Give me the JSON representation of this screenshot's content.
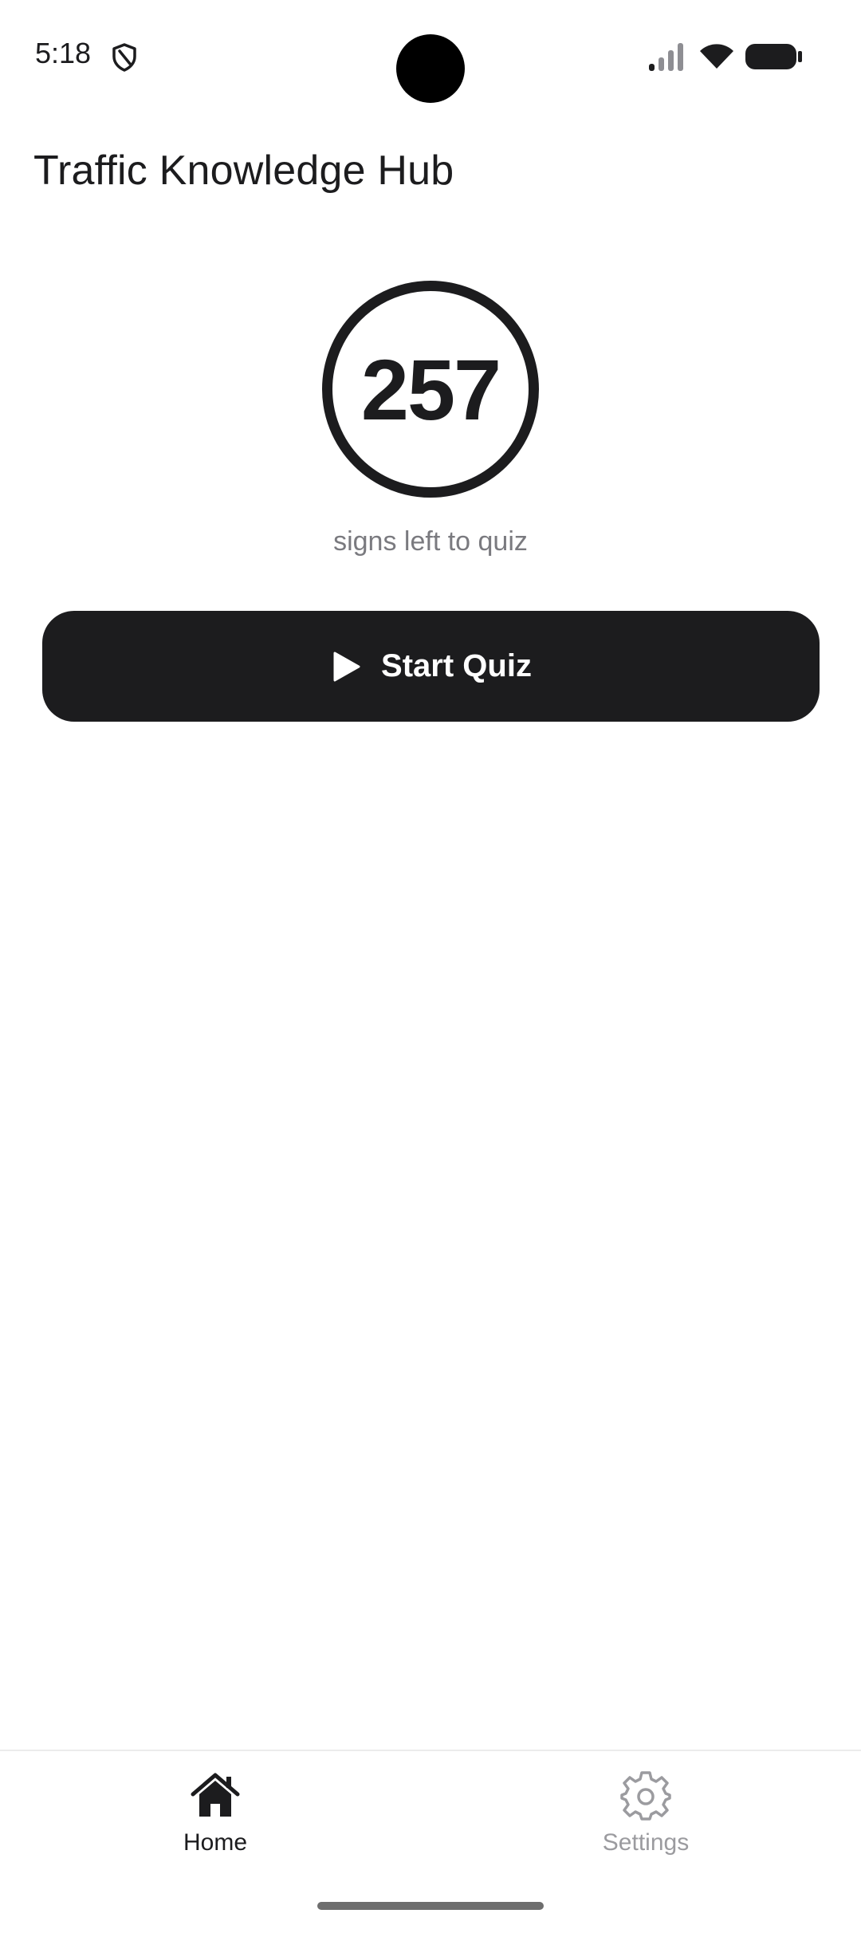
{
  "status_bar": {
    "time": "5:18",
    "icons": [
      "shield-icon",
      "signal-icon",
      "wifi-icon",
      "battery-icon"
    ]
  },
  "header": {
    "title": "Traffic Knowledge Hub"
  },
  "counter": {
    "value": "257",
    "caption": "signs left to quiz"
  },
  "start_button": {
    "label": "Start Quiz",
    "icon": "play-icon"
  },
  "tab_bar": {
    "tabs": [
      {
        "label": "Home",
        "icon": "home-icon",
        "active": true
      },
      {
        "label": "Settings",
        "icon": "gear-icon",
        "active": false
      }
    ]
  },
  "colors": {
    "primary": "#1c1c1e",
    "caption": "#7a7a7f",
    "inactive_tab": "#9b9b9f",
    "background": "#ffffff"
  }
}
